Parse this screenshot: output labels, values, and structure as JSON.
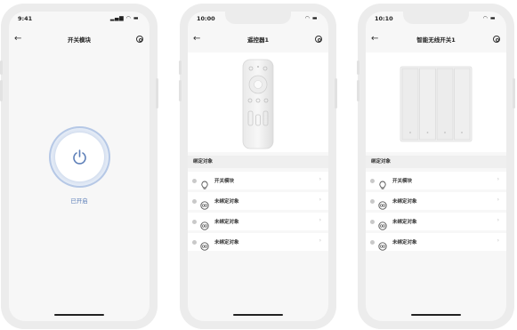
{
  "phones": [
    {
      "status_time": "9:41",
      "nav_title": "开关模块",
      "power_status": "已开启"
    },
    {
      "status_time": "10:00",
      "nav_title": "遥控器1",
      "section_title": "绑定对象",
      "rows": [
        {
          "label": "开关模块",
          "icon": "bulb-icon"
        },
        {
          "label": "未绑定对象",
          "icon": "link-icon"
        },
        {
          "label": "未绑定对象",
          "icon": "link-icon"
        },
        {
          "label": "未绑定对象",
          "icon": "link-icon"
        }
      ]
    },
    {
      "status_time": "10:10",
      "nav_title": "智能无线开关1",
      "section_title": "绑定对象",
      "rows": [
        {
          "label": "开关模块",
          "icon": "bulb-icon"
        },
        {
          "label": "未绑定对象",
          "icon": "link-icon"
        },
        {
          "label": "未绑定对象",
          "icon": "link-icon"
        },
        {
          "label": "未绑定对象",
          "icon": "link-icon"
        }
      ]
    }
  ],
  "colors": {
    "accent": "#5d7fb8",
    "ring": "#b7c9e6",
    "frame": "#ececec",
    "screen_bg": "#f7f7f7"
  }
}
